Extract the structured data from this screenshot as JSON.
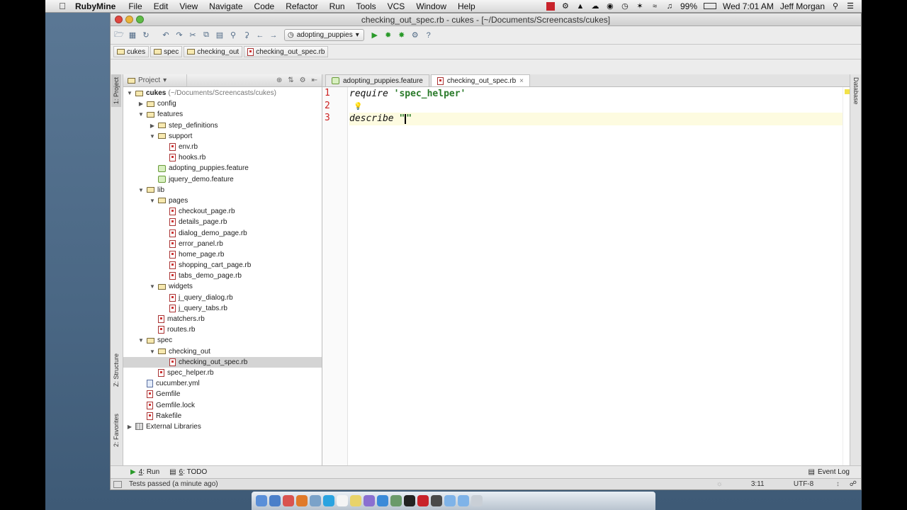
{
  "menubar": {
    "app": "RubyMine",
    "items": [
      "File",
      "Edit",
      "View",
      "Navigate",
      "Code",
      "Refactor",
      "Run",
      "Tools",
      "VCS",
      "Window",
      "Help"
    ],
    "battery": "99%",
    "clock": "Wed 7:01 AM",
    "user": "Jeff Morgan"
  },
  "window": {
    "title": "checking_out_spec.rb - cukes - [~/Documents/Screencasts/cukes]"
  },
  "toolbar": {
    "run_config": "adopting_puppies"
  },
  "breadcrumbs": [
    "cukes",
    "spec",
    "checking_out",
    "checking_out_spec.rb"
  ],
  "sidebar": {
    "tabs": [
      "1: Project",
      "Z: Structure",
      "2: Favorites"
    ],
    "right_tabs": [
      "Database"
    ]
  },
  "project": {
    "view": "Project",
    "root_name": "cukes",
    "root_path": "(~/Documents/Screencasts/cukes)",
    "tree": [
      {
        "depth": 1,
        "type": "folder",
        "open": false,
        "label": "config"
      },
      {
        "depth": 1,
        "type": "folder",
        "open": true,
        "label": "features"
      },
      {
        "depth": 2,
        "type": "folder",
        "open": false,
        "label": "step_definitions"
      },
      {
        "depth": 2,
        "type": "folder",
        "open": true,
        "label": "support"
      },
      {
        "depth": 3,
        "type": "rb",
        "label": "env.rb"
      },
      {
        "depth": 3,
        "type": "rb",
        "label": "hooks.rb"
      },
      {
        "depth": 2,
        "type": "feature",
        "label": "adopting_puppies.feature"
      },
      {
        "depth": 2,
        "type": "feature",
        "label": "jquery_demo.feature"
      },
      {
        "depth": 1,
        "type": "folder",
        "open": true,
        "label": "lib"
      },
      {
        "depth": 2,
        "type": "folder",
        "open": true,
        "label": "pages"
      },
      {
        "depth": 3,
        "type": "rb",
        "label": "checkout_page.rb"
      },
      {
        "depth": 3,
        "type": "rb",
        "label": "details_page.rb"
      },
      {
        "depth": 3,
        "type": "rb",
        "label": "dialog_demo_page.rb"
      },
      {
        "depth": 3,
        "type": "rb",
        "label": "error_panel.rb"
      },
      {
        "depth": 3,
        "type": "rb",
        "label": "home_page.rb"
      },
      {
        "depth": 3,
        "type": "rb",
        "label": "shopping_cart_page.rb"
      },
      {
        "depth": 3,
        "type": "rb",
        "label": "tabs_demo_page.rb"
      },
      {
        "depth": 2,
        "type": "folder",
        "open": true,
        "label": "widgets"
      },
      {
        "depth": 3,
        "type": "rb",
        "label": "j_query_dialog.rb"
      },
      {
        "depth": 3,
        "type": "rb",
        "label": "j_query_tabs.rb"
      },
      {
        "depth": 2,
        "type": "rb",
        "label": "matchers.rb"
      },
      {
        "depth": 2,
        "type": "rb",
        "label": "routes.rb"
      },
      {
        "depth": 1,
        "type": "folder",
        "open": true,
        "label": "spec"
      },
      {
        "depth": 2,
        "type": "folder",
        "open": true,
        "label": "checking_out"
      },
      {
        "depth": 3,
        "type": "rb",
        "label": "checking_out_spec.rb",
        "selected": true
      },
      {
        "depth": 2,
        "type": "rb",
        "label": "spec_helper.rb"
      },
      {
        "depth": 1,
        "type": "yml",
        "label": "cucumber.yml"
      },
      {
        "depth": 1,
        "type": "rb",
        "label": "Gemfile"
      },
      {
        "depth": 1,
        "type": "rb",
        "label": "Gemfile.lock"
      },
      {
        "depth": 1,
        "type": "rb",
        "label": "Rakefile"
      },
      {
        "depth": 0,
        "type": "lib",
        "open": false,
        "label": "External Libraries"
      }
    ]
  },
  "editor": {
    "tabs": [
      {
        "label": "adopting_puppies.feature",
        "type": "feature",
        "active": false
      },
      {
        "label": "checking_out_spec.rb",
        "type": "rb",
        "active": true
      }
    ],
    "lines": [
      {
        "num": "1",
        "kw": "require",
        "str": "'spec_helper'"
      },
      {
        "num": "2",
        "kw": "",
        "str": ""
      },
      {
        "num": "3",
        "kw": "describe",
        "str": "\""
      }
    ],
    "line3_tail": "\""
  },
  "bottom_tools": {
    "run_num": "4",
    "run_label": ": Run",
    "todo_num": "6",
    "todo_label": ": TODO",
    "event_log": "Event Log"
  },
  "status": {
    "message": "Tests passed (a minute ago)",
    "position": "3:11",
    "encoding": "UTF-8"
  }
}
